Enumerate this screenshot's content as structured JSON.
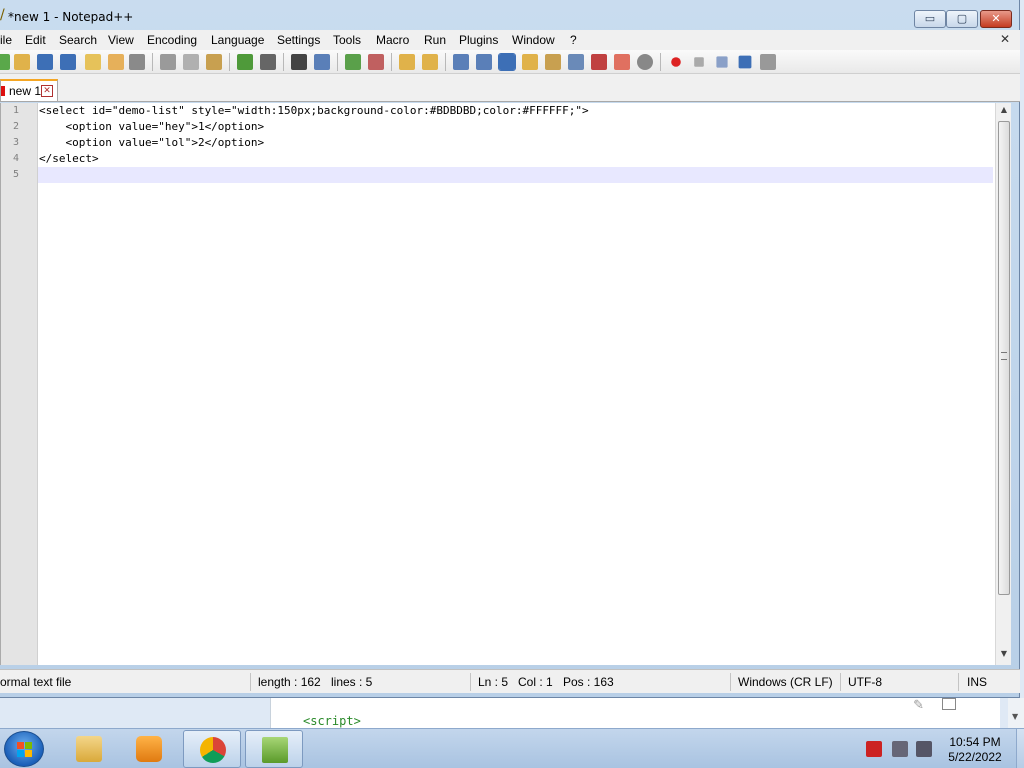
{
  "window": {
    "title": "*new 1 - Notepad++",
    "caption_min": "▭",
    "caption_max": "▢",
    "caption_close": "✕"
  },
  "menu": {
    "items": [
      "ile",
      "Edit",
      "Search",
      "View",
      "Encoding",
      "Language",
      "Settings",
      "Tools",
      "Macro",
      "Run",
      "Plugins",
      "Window",
      "?"
    ],
    "close_glyph": "✕"
  },
  "tab": {
    "label": "new 1",
    "close_glyph": "✕"
  },
  "editor": {
    "line_numbers": [
      "1",
      "2",
      "3",
      "4",
      "5"
    ],
    "lines": [
      "<select id=\"demo-list\" style=\"width:150px;background-color:#BDBDBD;color:#FFFFFF;\">",
      "    <option value=\"hey\">1</option>",
      "    <option value=\"lol\">2</option>",
      "</select>",
      ""
    ],
    "current_line_color": "#e8e8ff"
  },
  "status": {
    "file_type": "ormal text file",
    "length": "length : 162",
    "lines": "lines : 5",
    "ln": "Ln : 5",
    "col": "Col : 1",
    "pos": "Pos : 163",
    "eol": "Windows (CR LF)",
    "encoding": "UTF-8",
    "mode": "INS"
  },
  "background_window": {
    "code_snippet": "<script>",
    "pen_glyph": "✎"
  },
  "taskbar": {
    "clock_time": "10:54 PM",
    "clock_date": "5/22/2022",
    "apps": [
      "explorer-icon",
      "media-player-icon",
      "chrome-icon",
      "notepadpp-icon"
    ]
  },
  "colors": {
    "close_button": "#c43b21",
    "tab_accent": "#f5a623",
    "gutter": "#e4e4e4"
  }
}
